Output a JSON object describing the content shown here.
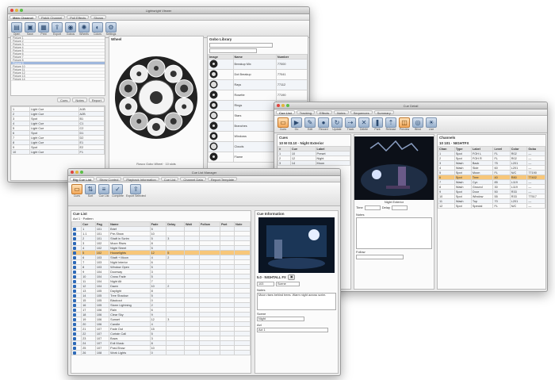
{
  "window_back": {
    "title": "Lightwright Viewer",
    "tabs": [
      "Main Channel",
      "Patch Channel",
      "Pull Effects",
      "Shows"
    ],
    "toolbar": [
      {
        "label": "Open",
        "icon": "folder-icon"
      },
      {
        "label": "Save",
        "icon": "disk-icon"
      },
      {
        "label": "Print",
        "icon": "printer-icon"
      },
      {
        "label": "Export",
        "icon": "export-icon"
      },
      {
        "label": "Gobos",
        "icon": "gobo-icon"
      },
      {
        "label": "Wheels",
        "icon": "wheel-icon"
      },
      {
        "label": "Colors",
        "icon": "color-icon"
      },
      {
        "label": "Settings",
        "icon": "gear-icon"
      }
    ],
    "wheel_panel_title": "Wheel",
    "wheel_caption": "Rosco Gobo Wheel · 10 slots",
    "gobo_panel_title": "Gobo Library",
    "gobo_columns": [
      "Image",
      "Name",
      "Number"
    ],
    "gobo_rows": [
      [
        "Breakup Mix",
        "77000"
      ],
      [
        "Dot Breakup",
        "77041"
      ],
      [
        "Rays",
        "77112"
      ],
      [
        "Rosette",
        "77190"
      ],
      [
        "Rings",
        "77221"
      ],
      [
        "Stars",
        "77318"
      ],
      [
        "Branches",
        "77402"
      ],
      [
        "Windows",
        "77517"
      ],
      [
        "Clouds",
        "77630"
      ],
      [
        "Flame",
        "77702"
      ]
    ],
    "list_lines": [
      "Fixture 1",
      "Fixture 2",
      "Fixture 3",
      "Fixture 4",
      "Fixture 5",
      "Fixture 6",
      "Fixture 7",
      "Fixture 8",
      "Fixture 9",
      "Fixture 10",
      "Fixture 11",
      "Fixture 12",
      "Fixture 13",
      "Fixture 14"
    ],
    "bottom_tabs": [
      "Cues",
      "Notes",
      "Report"
    ],
    "small_rows": [
      [
        "1",
        "Light Cue",
        "A1B"
      ],
      [
        "2",
        "Light Cue",
        "A2B"
      ],
      [
        "3",
        "Spot",
        "B1"
      ],
      [
        "4",
        "Light Cue",
        "C1"
      ],
      [
        "5",
        "Light Cue",
        "C2"
      ],
      [
        "6",
        "Spot",
        "D1"
      ],
      [
        "7",
        "Light Cue",
        "D2"
      ],
      [
        "8",
        "Light Cue",
        "E1"
      ],
      [
        "9",
        "Spot",
        "E2"
      ],
      [
        "10",
        "Light Cue",
        "F1"
      ]
    ]
  },
  "window_right": {
    "title": "Cue Detail",
    "tabs": [
      "Cue List",
      "Tracking",
      "Effects",
      "Notes",
      "Sequences",
      "Summary"
    ],
    "toolbar": [
      {
        "label": "Cues",
        "icon": "cue-icon",
        "selected": true
      },
      {
        "label": "Go",
        "icon": "go-icon"
      },
      {
        "label": "Edit",
        "icon": "pencil-icon"
      },
      {
        "label": "Record",
        "icon": "record-icon"
      },
      {
        "label": "Update",
        "icon": "update-icon"
      },
      {
        "label": "Track",
        "icon": "track-icon"
      },
      {
        "label": "Delete",
        "icon": "trash-icon"
      },
      {
        "label": "Park",
        "icon": "park-icon"
      },
      {
        "label": "Release",
        "icon": "release-icon"
      },
      {
        "label": "Preview",
        "icon": "preview-icon",
        "selected": true
      },
      {
        "label": "Blind",
        "icon": "eye-icon"
      },
      {
        "label": "Live",
        "icon": "live-icon"
      }
    ],
    "left_heading": "Cues",
    "cue_title": "10 M 03.10 · Night Exterior",
    "left_columns": [
      "#",
      "Cue",
      "Label"
    ],
    "left_rows": [
      [
        "1",
        "10",
        "Preset"
      ],
      [
        "2",
        "12",
        "Night"
      ],
      [
        "3",
        "14",
        "Moon"
      ]
    ],
    "preview_caption": "Night Exterior",
    "fields": {
      "label_a": "Time",
      "label_b": "Delay",
      "label_c": "Notes",
      "label_d": "Follow"
    },
    "right_heading": "Channels",
    "right_title": "10 101 · NIGHTFX",
    "right_columns": [
      "Chan",
      "Type",
      "Label",
      "Level",
      "Color",
      "Gobo"
    ],
    "right_rows": [
      [
        "1",
        "Spot",
        "FOH L",
        "FL",
        "R02",
        "—"
      ],
      [
        "2",
        "Spot",
        "FOH R",
        "FL",
        "R02",
        "—"
      ],
      [
        "3",
        "Wash",
        "Back",
        "75",
        "L201",
        "—"
      ],
      [
        "4",
        "Wash",
        "Side",
        "60",
        "L201",
        "—"
      ],
      [
        "5",
        "Spot",
        "Moon",
        "FL",
        "N/C",
        "77190"
      ],
      [
        "6",
        "Spot",
        "Tree",
        "40",
        "R80",
        "77402"
      ],
      [
        "7",
        "Wash",
        "Cyc",
        "85",
        "L119",
        "—"
      ],
      [
        "8",
        "Wash",
        "Ground",
        "30",
        "L119",
        "—"
      ],
      [
        "9",
        "Spot",
        "Door",
        "50",
        "R33",
        "—"
      ],
      [
        "10",
        "Spot",
        "Window",
        "55",
        "R33",
        "77517"
      ],
      [
        "11",
        "Wash",
        "Top",
        "70",
        "L201",
        "—"
      ],
      [
        "12",
        "Spot",
        "Special",
        "FL",
        "N/C",
        "—"
      ]
    ],
    "highlighted_index": 5
  },
  "window_front": {
    "title": "Cue List Manager",
    "tabs": [
      "Big Cue List",
      "Show Control",
      "Playback Information",
      "Cue List",
      "Channel Data",
      "Report Template"
    ],
    "toolbar": [
      {
        "label": "Cues",
        "icon": "cue-icon",
        "selected": true
      },
      {
        "label": "Sort",
        "icon": "sort-icon"
      },
      {
        "label": "Cue List",
        "icon": "list-icon"
      },
      {
        "label": "Complete",
        "icon": "check-icon"
      },
      {
        "label": "Export Selected",
        "icon": "export-icon"
      }
    ],
    "cuelist_label": "Cue List",
    "cuelist_sub": "Act 1 · Pattern",
    "columns": [
      "",
      "Cue",
      "Pag",
      "Name",
      "Fade",
      "Delay",
      "Wait",
      "Follow",
      "Part",
      "Note"
    ],
    "rows": [
      [
        "",
        "1",
        "101",
        "Brief",
        "5",
        "",
        "",
        "",
        "",
        ""
      ],
      [
        "",
        "1.1",
        "101",
        "Pre-Show",
        "10",
        "",
        "",
        "",
        "",
        ""
      ],
      [
        "",
        "2",
        "101",
        "Shaft in Scrim",
        "5",
        "3",
        "",
        "",
        "",
        ""
      ],
      [
        "",
        "3",
        "102",
        "Moon Rises",
        "8",
        "",
        "",
        "",
        "",
        ""
      ],
      [
        "",
        "4",
        "102",
        "Night Street",
        "5",
        "",
        "",
        "",
        "",
        ""
      ],
      [
        "",
        "5",
        "102",
        "Houselights",
        "12",
        "5",
        "",
        "",
        "",
        ""
      ],
      [
        "",
        "6",
        "103",
        "Shaft + Moon",
        "4",
        "2",
        "",
        "",
        "",
        ""
      ],
      [
        "",
        "7",
        "103",
        "Night Interior",
        "6",
        "",
        "",
        "",
        "",
        ""
      ],
      [
        "",
        "8",
        "103",
        "Window Open",
        "5",
        "",
        "",
        "",
        "",
        ""
      ],
      [
        "",
        "9",
        "104",
        "Doorway",
        "3",
        "",
        "",
        "",
        "",
        ""
      ],
      [
        "",
        "10",
        "104",
        "Cross Fade",
        "5",
        "",
        "",
        "",
        "",
        ""
      ],
      [
        "",
        "11",
        "104",
        "Night Alt",
        "7",
        "",
        "",
        "",
        "",
        ""
      ],
      [
        "",
        "12",
        "104",
        "Dawn",
        "10",
        "2",
        "",
        "",
        "",
        ""
      ],
      [
        "",
        "13",
        "105",
        "Daylight",
        "8",
        "",
        "",
        "",
        "",
        ""
      ],
      [
        "",
        "14",
        "105",
        "Tree Shadow",
        "5",
        "",
        "",
        "",
        "",
        ""
      ],
      [
        "",
        "15",
        "105",
        "Blackout",
        "0",
        "",
        "",
        "",
        "",
        ""
      ],
      [
        "",
        "16",
        "105",
        "Storm Lightning",
        "2",
        "",
        "",
        "",
        "",
        ""
      ],
      [
        "",
        "17",
        "106",
        "Rain",
        "6",
        "",
        "",
        "",
        "",
        ""
      ],
      [
        "",
        "18",
        "106",
        "Clear Sky",
        "9",
        "",
        "",
        "",
        "",
        ""
      ],
      [
        "",
        "19",
        "106",
        "Sunset",
        "12",
        "3",
        "",
        "",
        "",
        ""
      ],
      [
        "",
        "20",
        "106",
        "Candle",
        "4",
        "",
        "",
        "",
        "",
        ""
      ],
      [
        "",
        "21",
        "107",
        "Fade Out",
        "15",
        "",
        "",
        "",
        "",
        ""
      ],
      [
        "",
        "22",
        "107",
        "Curtain Call",
        "5",
        "",
        "",
        "",
        "",
        ""
      ],
      [
        "",
        "23",
        "107",
        "Bows",
        "3",
        "",
        "",
        "",
        "",
        ""
      ],
      [
        "",
        "24",
        "107",
        "Exit Music",
        "8",
        "",
        "",
        "",
        "",
        ""
      ],
      [
        "",
        "25",
        "107",
        "Post-Show",
        "10",
        "",
        "",
        "",
        "",
        ""
      ],
      [
        "",
        "26",
        "108",
        "Work Lights",
        "0",
        "",
        "",
        "",
        "",
        ""
      ]
    ],
    "highlighted_index": 5,
    "info_heading": "Cue Information",
    "cue_number": "5.0 · NIGHTALL FX",
    "cue_field_a": "103",
    "cue_field_b": "Scene",
    "notes_label": "Notes",
    "notes_text": "Moon rises behind trees. Warm night across scrim.",
    "scene_label": "Scene",
    "scene_value": "Night",
    "sub_label": "Act",
    "sub_value": "Act 1"
  }
}
